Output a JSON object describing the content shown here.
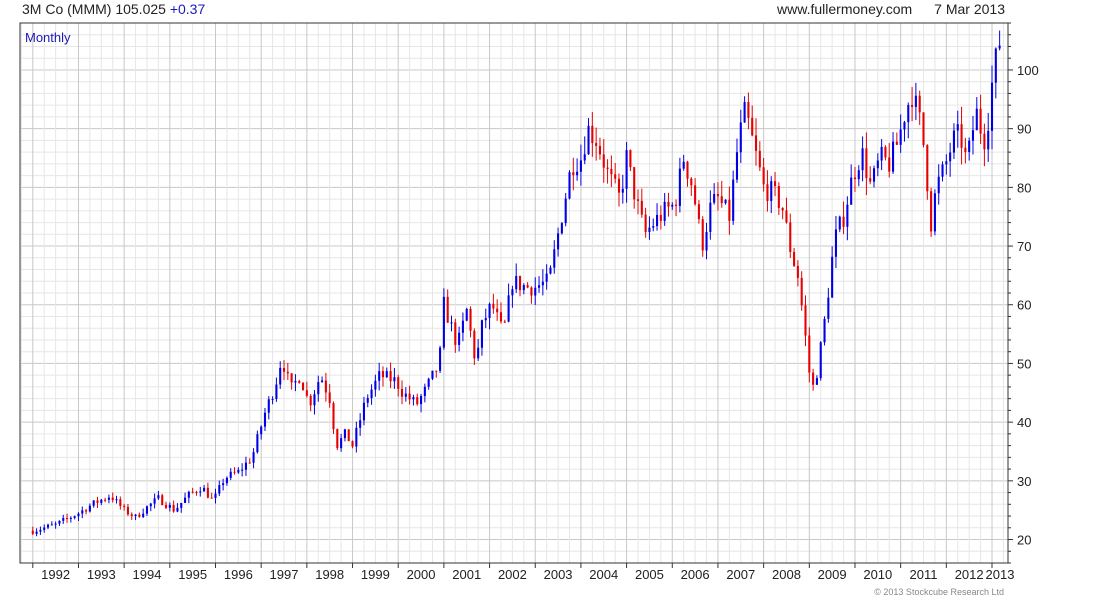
{
  "header": {
    "ticker": "3M Co (MMM)",
    "price": "105.025",
    "change": "+0.37",
    "site": "www.fullermoney.com",
    "date": "7 Mar 2013"
  },
  "footer": {
    "copyright": "© 2013 Stockcube Research Ltd"
  },
  "colors": {
    "up": "#0000e6",
    "down": "#e60000",
    "grid_major": "#c8c8c8",
    "grid_minor": "#e6e6e6",
    "axis": "#333333",
    "interval_label": "#1a1ab8"
  },
  "chart_data": {
    "type": "candlestick",
    "interval_label": "Monthly",
    "x_range": [
      1991.72,
      2013.35
    ],
    "ylim": [
      16,
      108
    ],
    "y_ticks": [
      20,
      30,
      40,
      50,
      60,
      70,
      80,
      90,
      100
    ],
    "x_tick_labels": [
      "1992",
      "1993",
      "1994",
      "1995",
      "1996",
      "1997",
      "1998",
      "1999",
      "2000",
      "2001",
      "2002",
      "2003",
      "2004",
      "2005",
      "2006",
      "2007",
      "2008",
      "2009",
      "2010",
      "2011",
      "2012",
      "2013"
    ],
    "y_axis_side": "right",
    "grid": true,
    "close_path": [
      [
        1992.0,
        21.5
      ],
      [
        1992.5,
        22.5
      ],
      [
        1993.0,
        24.5
      ],
      [
        1993.3,
        26.0
      ],
      [
        1993.7,
        27.5
      ],
      [
        1994.0,
        25.0
      ],
      [
        1994.25,
        23.8
      ],
      [
        1994.5,
        25.5
      ],
      [
        1994.75,
        27.0
      ],
      [
        1995.1,
        25.0
      ],
      [
        1995.4,
        27.5
      ],
      [
        1995.7,
        29.0
      ],
      [
        1995.95,
        26.5
      ],
      [
        1996.2,
        30.5
      ],
      [
        1996.5,
        31.5
      ],
      [
        1996.8,
        34.0
      ],
      [
        1997.1,
        42.0
      ],
      [
        1997.3,
        46.0
      ],
      [
        1997.45,
        51.0
      ],
      [
        1997.65,
        45.5
      ],
      [
        1997.85,
        48.0
      ],
      [
        1998.05,
        43.0
      ],
      [
        1998.3,
        48.0
      ],
      [
        1998.5,
        44.0
      ],
      [
        1998.65,
        36.0
      ],
      [
        1998.85,
        38.0
      ],
      [
        1999.0,
        36.0
      ],
      [
        1999.3,
        44.0
      ],
      [
        1999.6,
        48.0
      ],
      [
        1999.95,
        47.0
      ],
      [
        2000.1,
        45.0
      ],
      [
        2000.4,
        43.0
      ],
      [
        2000.6,
        45.5
      ],
      [
        2000.9,
        50.0
      ],
      [
        2001.0,
        60.0
      ],
      [
        2001.3,
        53.0
      ],
      [
        2001.5,
        59.0
      ],
      [
        2001.7,
        50.0
      ],
      [
        2001.85,
        57.0
      ],
      [
        2002.05,
        60.0
      ],
      [
        2002.3,
        55.0
      ],
      [
        2002.5,
        64.0
      ],
      [
        2002.8,
        63.0
      ],
      [
        2003.0,
        63.0
      ],
      [
        2003.3,
        64.0
      ],
      [
        2003.5,
        72.0
      ],
      [
        2003.8,
        84.0
      ],
      [
        2004.0,
        85.0
      ],
      [
        2004.15,
        90.0
      ],
      [
        2004.35,
        88.0
      ],
      [
        2004.6,
        82.0
      ],
      [
        2004.85,
        78.0
      ],
      [
        2005.0,
        85.0
      ],
      [
        2005.2,
        78.0
      ],
      [
        2005.4,
        72.0
      ],
      [
        2005.6,
        74.0
      ],
      [
        2005.85,
        76.0
      ],
      [
        2006.05,
        77.0
      ],
      [
        2006.25,
        85.0
      ],
      [
        2006.45,
        80.0
      ],
      [
        2006.65,
        70.0
      ],
      [
        2006.85,
        77.0
      ],
      [
        2007.0,
        78.0
      ],
      [
        2007.25,
        75.0
      ],
      [
        2007.45,
        88.0
      ],
      [
        2007.6,
        93.0
      ],
      [
        2007.75,
        88.0
      ],
      [
        2008.0,
        80.0
      ],
      [
        2008.2,
        79.0
      ],
      [
        2008.4,
        77.0
      ],
      [
        2008.6,
        69.0
      ],
      [
        2008.75,
        65.0
      ],
      [
        2008.88,
        57.0
      ],
      [
        2009.05,
        45.0
      ],
      [
        2009.18,
        49.0
      ],
      [
        2009.35,
        58.0
      ],
      [
        2009.55,
        71.0
      ],
      [
        2009.75,
        75.0
      ],
      [
        2009.95,
        82.0
      ],
      [
        2010.15,
        86.0
      ],
      [
        2010.35,
        80.0
      ],
      [
        2010.55,
        85.0
      ],
      [
        2010.75,
        84.0
      ],
      [
        2010.95,
        88.0
      ],
      [
        2011.1,
        93.0
      ],
      [
        2011.25,
        96.0
      ],
      [
        2011.4,
        92.0
      ],
      [
        2011.55,
        85.0
      ],
      [
        2011.65,
        73.0
      ],
      [
        2011.78,
        80.0
      ],
      [
        2011.95,
        83.0
      ],
      [
        2012.15,
        88.0
      ],
      [
        2012.3,
        89.0
      ],
      [
        2012.45,
        84.0
      ],
      [
        2012.65,
        93.0
      ],
      [
        2012.82,
        88.0
      ],
      [
        2012.92,
        92.0
      ],
      [
        2013.02,
        99.0
      ],
      [
        2013.12,
        103.0
      ],
      [
        2013.17,
        105.0
      ]
    ]
  }
}
